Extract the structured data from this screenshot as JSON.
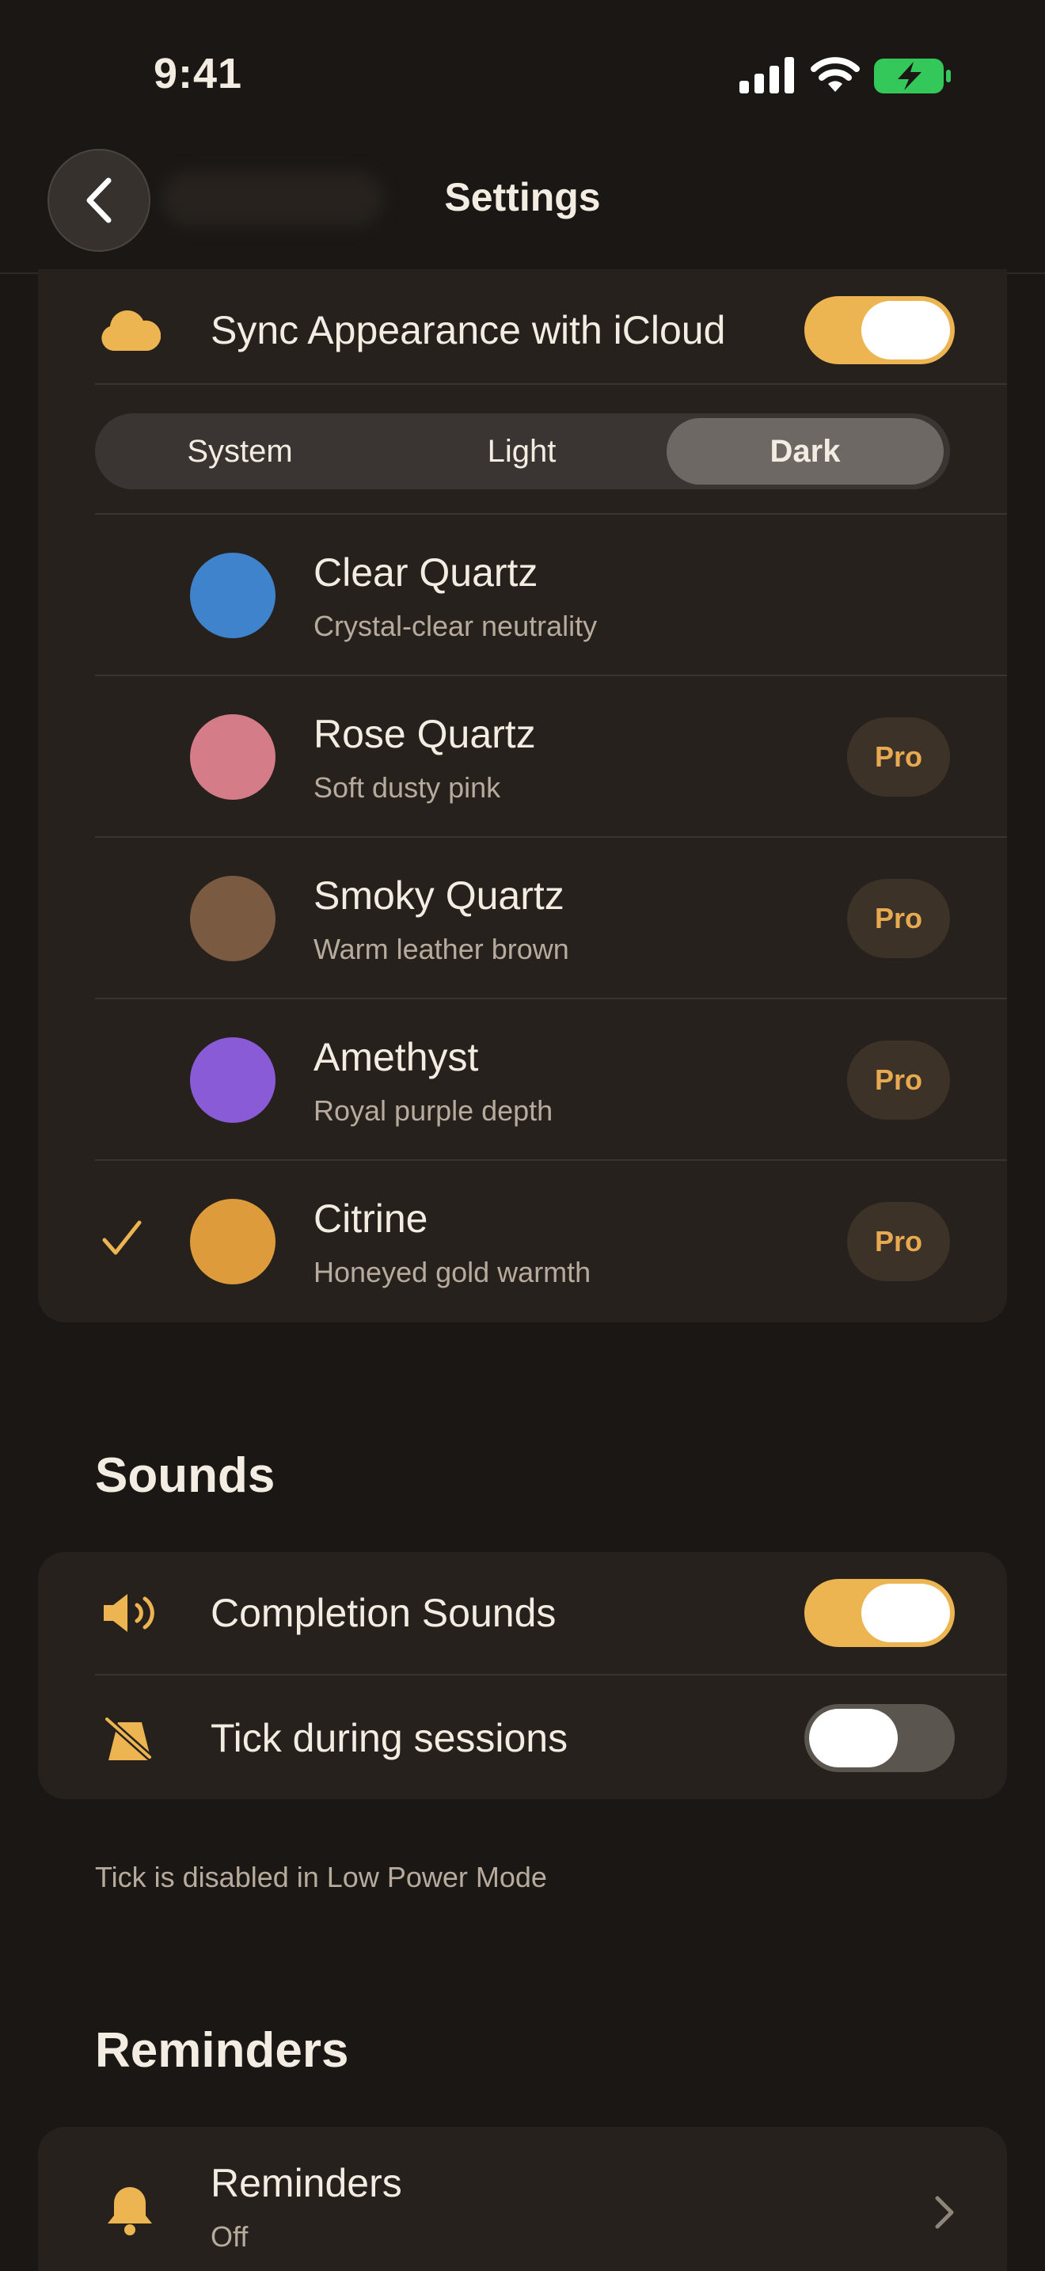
{
  "status_bar": {
    "time": "9:41",
    "battery_color": "#34c759"
  },
  "nav": {
    "title": "Settings",
    "back_icon": "chevron-left-icon"
  },
  "appearance": {
    "sync_label": "Sync Appearance with iCloud",
    "sync_on": true,
    "mode_options": [
      "System",
      "Light",
      "Dark"
    ],
    "selected_mode": "Dark",
    "themes": [
      {
        "name": "Clear Quartz",
        "description": "Crystal-clear neutrality",
        "color": "#3f83cd",
        "pro": false,
        "selected": false
      },
      {
        "name": "Rose Quartz",
        "description": "Soft dusty pink",
        "color": "#d47c88",
        "pro": true,
        "selected": false
      },
      {
        "name": "Smoky Quartz",
        "description": "Warm leather brown",
        "color": "#7a5a40",
        "pro": true,
        "selected": false
      },
      {
        "name": "Amethyst",
        "description": "Royal purple depth",
        "color": "#8a5bd6",
        "pro": true,
        "selected": false
      },
      {
        "name": "Citrine",
        "description": "Honeyed gold warmth",
        "color": "#dd9b3b",
        "pro": true,
        "selected": true
      }
    ],
    "pro_label": "Pro"
  },
  "sounds": {
    "section_title": "Sounds",
    "completion_label": "Completion Sounds",
    "completion_on": true,
    "tick_label": "Tick during sessions",
    "tick_on": false,
    "footnote": "Tick is disabled in Low Power Mode"
  },
  "reminders": {
    "section_title": "Reminders",
    "label": "Reminders",
    "value": "Off"
  },
  "colors": {
    "accent": "#ecb552",
    "background": "#1b1714",
    "card": "#27211d"
  }
}
